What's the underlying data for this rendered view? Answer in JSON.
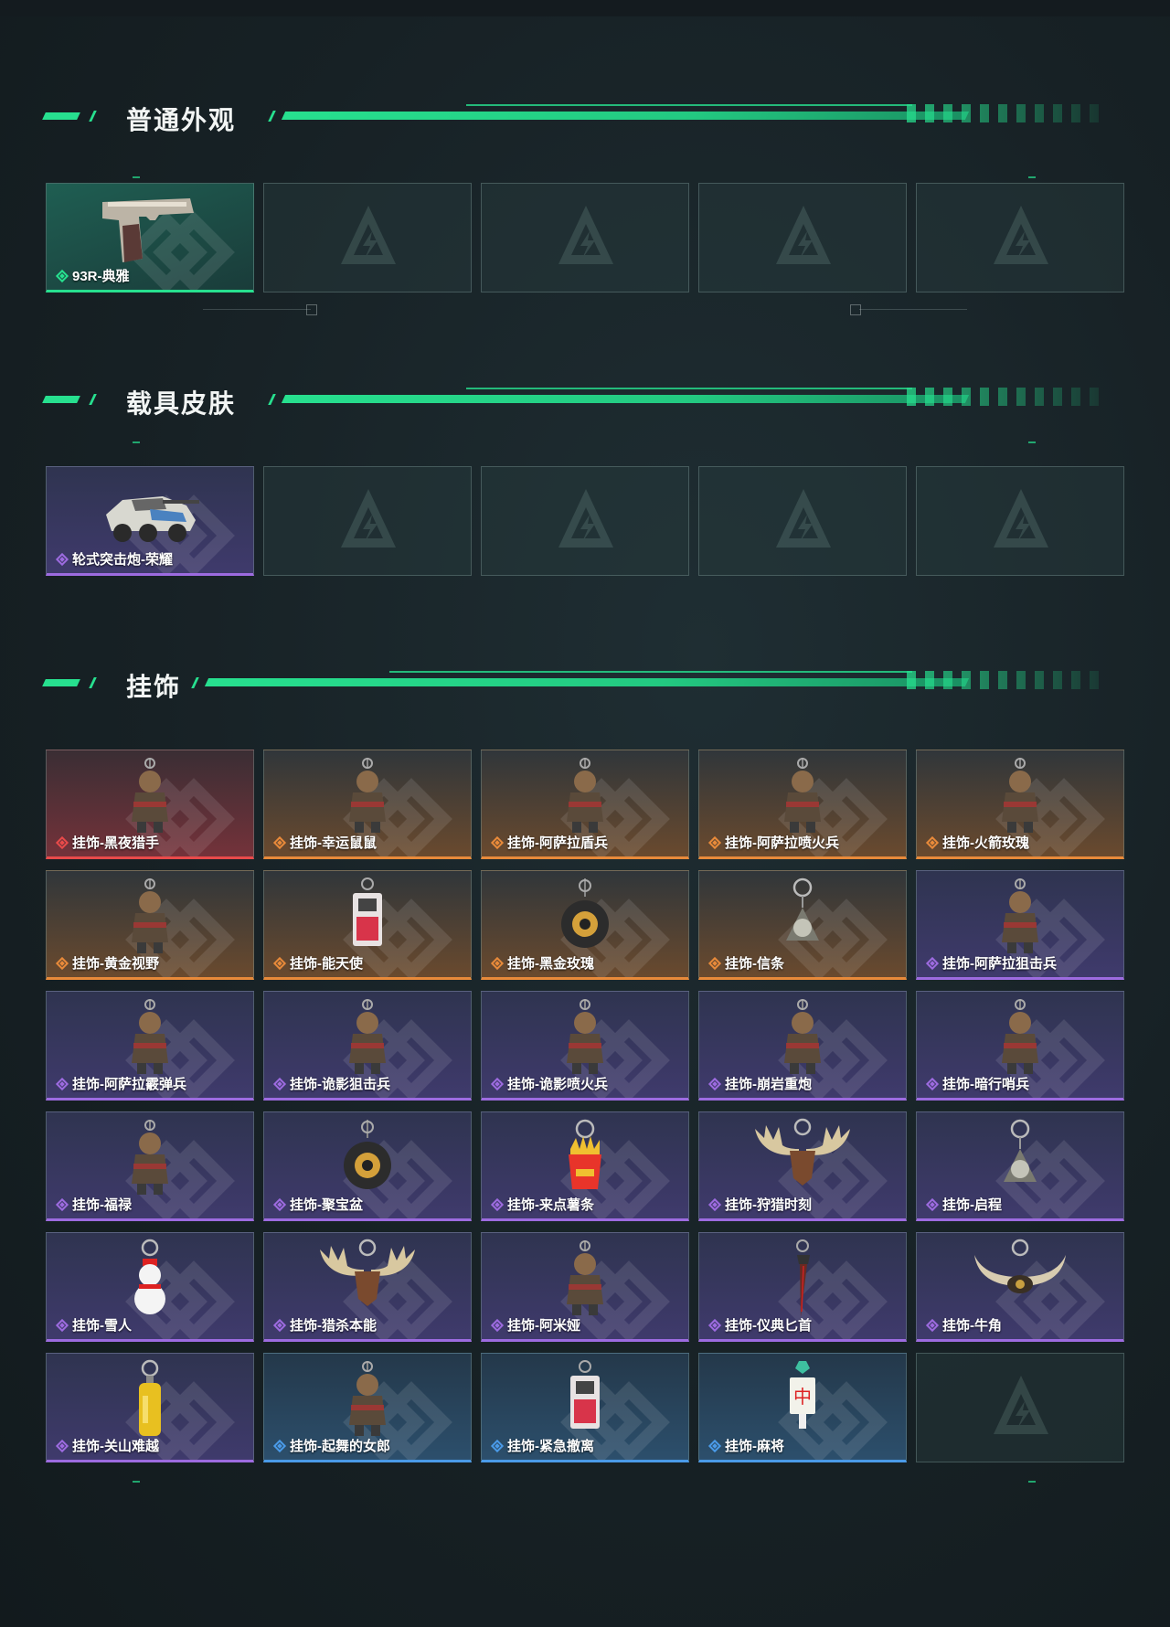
{
  "colors": {
    "accent": "#27e08f",
    "rarity_green": "#27e08f",
    "rarity_purple": "#9d6be0",
    "rarity_orange": "#e88a3a",
    "rarity_red": "#e84a4a",
    "rarity_blue": "#4a9ae8"
  },
  "sections": [
    {
      "title": "普通外观",
      "items": [
        {
          "label": "93R-典雅",
          "rarity": "green",
          "icon": "pistol-icon"
        },
        {
          "empty": true
        },
        {
          "empty": true
        },
        {
          "empty": true
        },
        {
          "empty": true
        }
      ]
    },
    {
      "title": "载具皮肤",
      "items": [
        {
          "label": "轮式突击炮-荣耀",
          "rarity": "purple",
          "icon": "armored-vehicle-icon"
        },
        {
          "empty": true
        },
        {
          "empty": true
        },
        {
          "empty": true
        },
        {
          "empty": true
        }
      ]
    },
    {
      "title": "挂饰",
      "items": [
        {
          "label": "挂饰-黑夜猎手",
          "rarity": "red",
          "icon": "figure-charm-icon"
        },
        {
          "label": "挂饰-幸运鼠鼠",
          "rarity": "orange",
          "icon": "figure-charm-icon"
        },
        {
          "label": "挂饰-阿萨拉盾兵",
          "rarity": "orange",
          "icon": "figure-charm-icon"
        },
        {
          "label": "挂饰-阿萨拉喷火兵",
          "rarity": "orange",
          "icon": "figure-charm-icon"
        },
        {
          "label": "挂饰-火箭玫瑰",
          "rarity": "orange",
          "icon": "figure-charm-icon"
        },
        {
          "label": "挂饰-黄金视野",
          "rarity": "orange",
          "icon": "figure-charm-icon"
        },
        {
          "label": "挂饰-能天使",
          "rarity": "orange",
          "icon": "card-charm-icon"
        },
        {
          "label": "挂饰-黑金玫瑰",
          "rarity": "orange",
          "icon": "round-charm-icon"
        },
        {
          "label": "挂饰-信条",
          "rarity": "orange",
          "icon": "ring-charm-icon"
        },
        {
          "label": "挂饰-阿萨拉狙击兵",
          "rarity": "purple",
          "icon": "figure-charm-icon"
        },
        {
          "label": "挂饰-阿萨拉霰弹兵",
          "rarity": "purple",
          "icon": "figure-charm-icon"
        },
        {
          "label": "挂饰-诡影狙击兵",
          "rarity": "purple",
          "icon": "figure-charm-icon"
        },
        {
          "label": "挂饰-诡影喷火兵",
          "rarity": "purple",
          "icon": "figure-charm-icon"
        },
        {
          "label": "挂饰-崩岩重炮",
          "rarity": "purple",
          "icon": "figure-charm-icon"
        },
        {
          "label": "挂饰-暗行哨兵",
          "rarity": "purple",
          "icon": "figure-charm-icon"
        },
        {
          "label": "挂饰-福禄",
          "rarity": "purple",
          "icon": "figure-charm-icon"
        },
        {
          "label": "挂饰-聚宝盆",
          "rarity": "purple",
          "icon": "round-charm-icon"
        },
        {
          "label": "挂饰-来点薯条",
          "rarity": "purple",
          "icon": "fries-charm-icon"
        },
        {
          "label": "挂饰-狩猎时刻",
          "rarity": "purple",
          "icon": "antler-charm-icon"
        },
        {
          "label": "挂饰-启程",
          "rarity": "purple",
          "icon": "ring-charm-icon"
        },
        {
          "label": "挂饰-雪人",
          "rarity": "purple",
          "icon": "snowman-charm-icon"
        },
        {
          "label": "挂饰-猎杀本能",
          "rarity": "purple",
          "icon": "antler-charm-icon"
        },
        {
          "label": "挂饰-阿米娅",
          "rarity": "purple",
          "icon": "figure-charm-icon"
        },
        {
          "label": "挂饰-仪典匕首",
          "rarity": "purple",
          "icon": "dagger-charm-icon"
        },
        {
          "label": "挂饰-牛角",
          "rarity": "purple",
          "icon": "horn-charm-icon"
        },
        {
          "label": "挂饰-关山难越",
          "rarity": "purple",
          "icon": "bottle-charm-icon"
        },
        {
          "label": "挂饰-起舞的女郎",
          "rarity": "blue",
          "icon": "figure-charm-icon"
        },
        {
          "label": "挂饰-紧急撤离",
          "rarity": "blue",
          "icon": "card-charm-icon"
        },
        {
          "label": "挂饰-麻将",
          "rarity": "blue",
          "icon": "mahjong-charm-icon"
        },
        {
          "empty": true
        }
      ]
    }
  ]
}
